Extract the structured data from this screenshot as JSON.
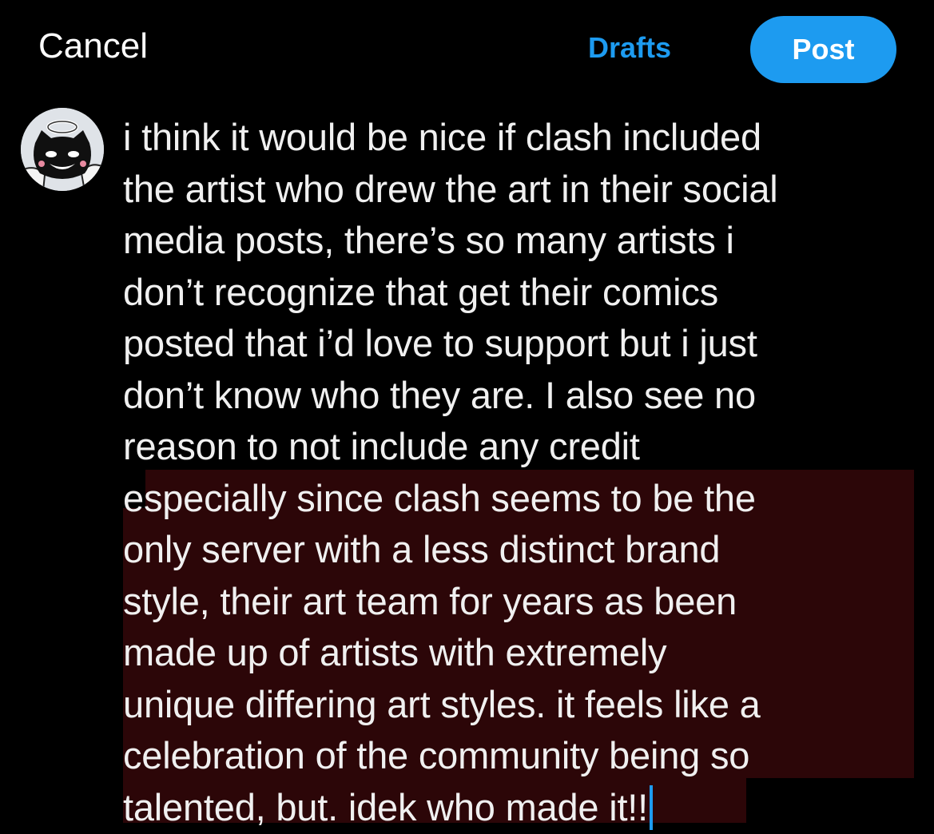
{
  "header": {
    "cancel_label": "Cancel",
    "drafts_label": "Drafts",
    "post_label": "Post"
  },
  "composer": {
    "lines": [
      "i think it would be nice if clash included",
      "the artist who drew the art in their social",
      "media posts, there’s so many artists i",
      "don’t recognize that get their comics",
      "posted that i’d love to support but i just",
      "don’t know who they are. I also see no",
      "reason to not include any credit",
      "especially since clash seems to be the",
      "only server with a less distinct brand",
      "style, their art team for years as been",
      "made up of artists with extremely",
      "unique differing art styles. it feels like a",
      "celebration of the community being so",
      "talented, but. idek who made it!!"
    ]
  },
  "colors": {
    "background": "#000000",
    "accent": "#1d9bf0",
    "text": "#f0f0f0",
    "selection_highlight": "#2c0608"
  },
  "icons": {
    "avatar": "cartoon-cat-avatar-with-halo"
  }
}
